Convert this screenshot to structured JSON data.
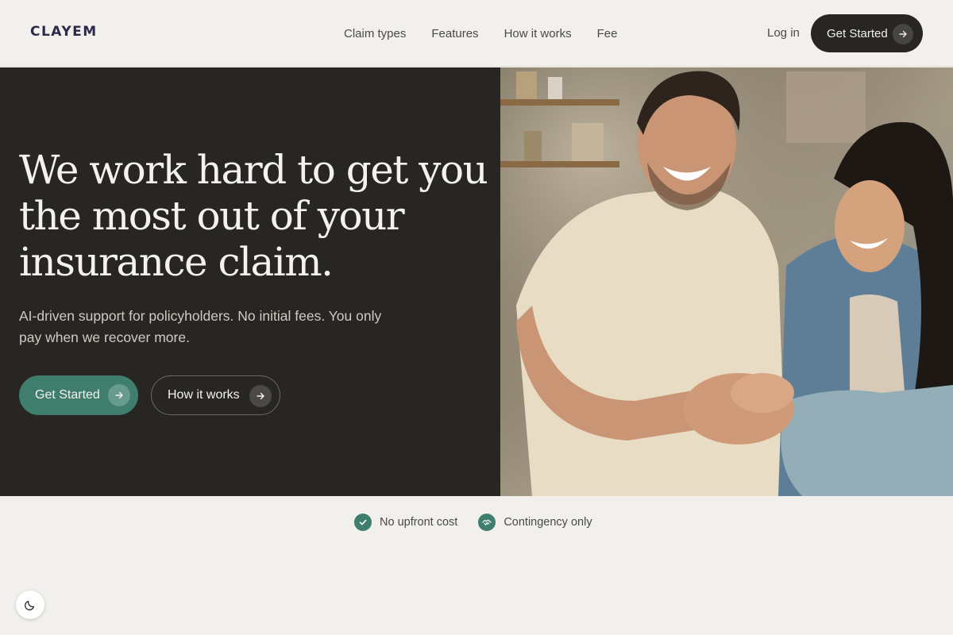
{
  "brand": {
    "logo": "CLAYEM"
  },
  "nav": {
    "items": [
      {
        "label": "Claim types"
      },
      {
        "label": "Features"
      },
      {
        "label": "How it works"
      },
      {
        "label": "Fee"
      }
    ],
    "login": "Log in",
    "cta": "Get Started"
  },
  "hero": {
    "title_lines": [
      "We work hard to get you",
      "the most out of your",
      "insurance claim."
    ],
    "subtitle_lines": [
      "AI-driven support for policyholders. No initial fees. You only",
      "pay when we recover more."
    ],
    "primary_cta": "Get Started",
    "secondary_cta": "How it works"
  },
  "badges": [
    {
      "label": "No upfront cost",
      "icon": "check-icon"
    },
    {
      "label": "Contingency only",
      "icon": "handshake-icon"
    }
  ],
  "colors": {
    "dark": "#272622",
    "accent": "#3f7d6d",
    "background": "#f2f0ec"
  }
}
